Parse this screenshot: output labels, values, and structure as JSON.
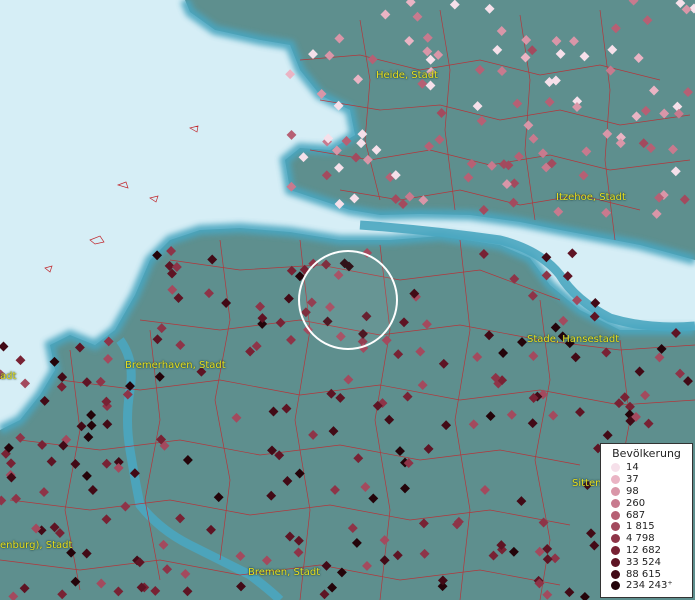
{
  "map": {
    "colors": {
      "sea": "#d6eef6",
      "land": "#5e8f8e",
      "coast": "#4aa6c0",
      "boundary": "#c1272d"
    },
    "labels": [
      {
        "id": "heide",
        "text": "Heide, Stadt"
      },
      {
        "id": "itzehoe",
        "text": "Itzehoe, Stadt"
      },
      {
        "id": "bremerhaven",
        "text": "Bremerhaven, Stadt"
      },
      {
        "id": "stade",
        "text": "Stade, Hansestadt"
      },
      {
        "id": "oldenburg",
        "text": "enburg), Stadt"
      },
      {
        "id": "bremen",
        "text": "Bremen, Stadt"
      },
      {
        "id": "sitten",
        "text": "Sitten"
      },
      {
        "id": "edge-left",
        "text": "adt"
      }
    ]
  },
  "legend": {
    "title": "Bevölkerung",
    "items": [
      {
        "value": "14",
        "color": "#f6e0ea"
      },
      {
        "value": "37",
        "color": "#eab4c4"
      },
      {
        "value": "98",
        "color": "#d996a8"
      },
      {
        "value": "260",
        "color": "#c87a8e"
      },
      {
        "value": "687",
        "color": "#b66074"
      },
      {
        "value": "1 815",
        "color": "#a34a5e"
      },
      {
        "value": "4 798",
        "color": "#8e3448"
      },
      {
        "value": "12 682",
        "color": "#782234"
      },
      {
        "value": "33 524",
        "color": "#5e1424"
      },
      {
        "value": "88 615",
        "color": "#420a16"
      },
      {
        "value": "234 243⁺",
        "color": "#24040a"
      }
    ]
  }
}
